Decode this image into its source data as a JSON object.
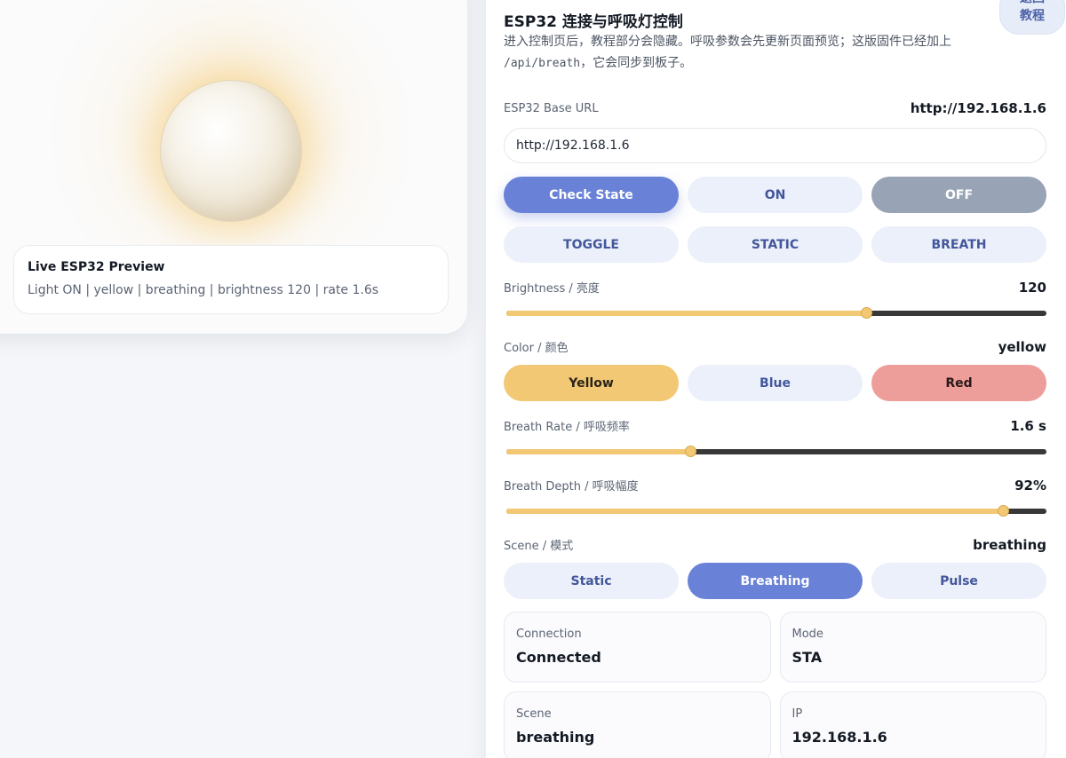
{
  "preview": {
    "title": "Live ESP32 Preview",
    "status": "Light ON | yellow | breathing | brightness 120 | rate 1.6s"
  },
  "header": {
    "back_tutorial_line1": "返回",
    "back_tutorial_line2": "教程",
    "title": "ESP32 连接与呼吸灯控制",
    "desc_part1": "进入控制页后，教程部分会隐藏。呼吸参数会先更新页面预览；这版固件已经加上 ",
    "desc_code": "/api/breath",
    "desc_part2": "，它会同步到板子。"
  },
  "base_url": {
    "label": "ESP32 Base URL",
    "current": "http://192.168.1.6",
    "input_value": "http://192.168.1.6"
  },
  "actions": {
    "check_state": "Check State",
    "on": "ON",
    "off": "OFF",
    "toggle": "TOGGLE",
    "static": "STATIC",
    "breath": "BREATH"
  },
  "brightness": {
    "label": "Brightness / 亮度",
    "value_text": "120",
    "value": 120,
    "max": 180
  },
  "color": {
    "label": "Color / 颜色",
    "value_text": "yellow",
    "options": [
      "Yellow",
      "Blue",
      "Red"
    ],
    "colors": {
      "yellow": "#f2c874",
      "blue": "#ebf0fb",
      "red": "#ed9e9a"
    }
  },
  "breath_rate": {
    "label": "Breath Rate / 呼吸频率",
    "value_text": "1.6 s",
    "fraction": 0.34
  },
  "breath_depth": {
    "label": "Breath Depth / 呼吸幅度",
    "value_text": "92%",
    "fraction": 0.92
  },
  "scene": {
    "label": "Scene / 模式",
    "value_text": "breathing",
    "options": [
      "Static",
      "Breathing",
      "Pulse"
    ],
    "selected": "Breathing"
  },
  "status": {
    "connection_label": "Connection",
    "connection_value": "Connected",
    "mode_label": "Mode",
    "mode_value": "STA",
    "scene_label": "Scene",
    "scene_value": "breathing",
    "ip_label": "IP",
    "ip_value": "192.168.1.6"
  },
  "accent_color": "#6981d6",
  "slider_fill_color": "#f2c874"
}
